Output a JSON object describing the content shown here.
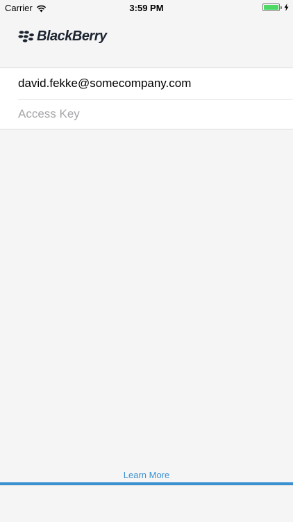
{
  "status_bar": {
    "carrier": "Carrier",
    "time": "3:59 PM",
    "battery_level": 1.0,
    "battery_color": "#4cd964",
    "wifi_icon": "wifi-icon",
    "charging_icon": "bolt-icon"
  },
  "brand": {
    "name": "BlackBerry",
    "logo_icon": "blackberry-logo-icon",
    "text_color": "#1c2430"
  },
  "form": {
    "email_value": "david.fekke@somecompany.com",
    "access_key_placeholder": "Access Key"
  },
  "footer": {
    "learn_more_label": "Learn More",
    "accent_color": "#3a91d1"
  }
}
